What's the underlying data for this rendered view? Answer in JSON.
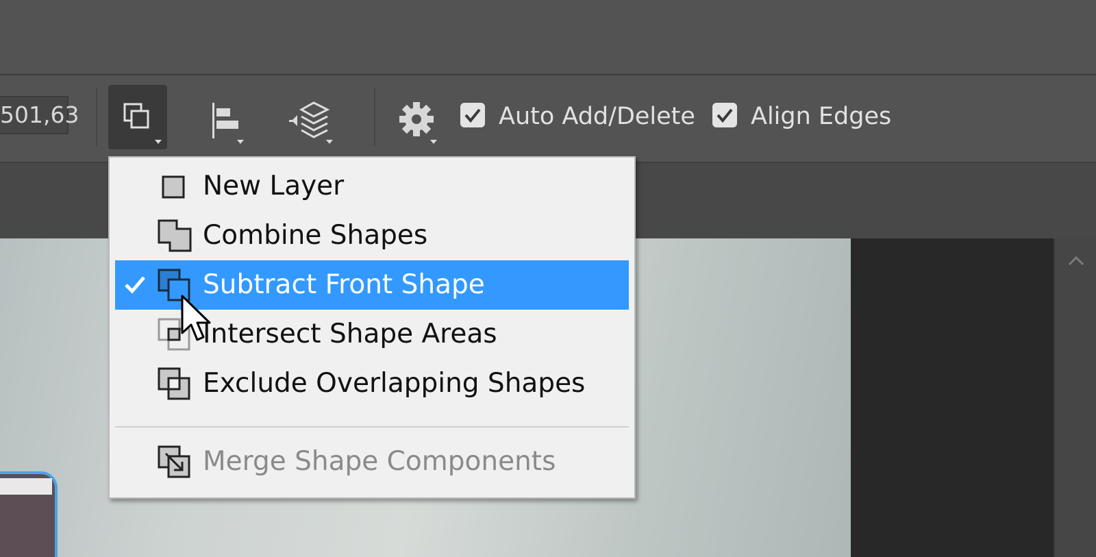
{
  "options_bar": {
    "coord_value": "501,63",
    "path_operations_icon": "path-operations-icon",
    "path_alignment_icon": "path-alignment-icon",
    "path_arrangement_icon": "path-arrangement-icon",
    "settings_icon": "gear-icon",
    "auto_add_delete": {
      "label": "Auto Add/Delete",
      "checked": true
    },
    "align_edges": {
      "label": "Align Edges",
      "checked": true
    }
  },
  "path_operations_menu": {
    "items": [
      {
        "label": "New Layer",
        "icon": "new-layer-icon",
        "selected": false,
        "checked": false,
        "enabled": true
      },
      {
        "label": "Combine Shapes",
        "icon": "combine-shapes-icon",
        "selected": false,
        "checked": false,
        "enabled": true
      },
      {
        "label": "Subtract Front Shape",
        "icon": "subtract-front-shape-icon",
        "selected": true,
        "checked": true,
        "enabled": true
      },
      {
        "label": "Intersect Shape Areas",
        "icon": "intersect-shape-areas-icon",
        "selected": false,
        "checked": false,
        "enabled": true
      },
      {
        "label": "Exclude Overlapping Shapes",
        "icon": "exclude-overlapping-shapes-icon",
        "selected": false,
        "checked": false,
        "enabled": true
      },
      {
        "label": "Merge Shape Components",
        "icon": "merge-shape-components-icon",
        "selected": false,
        "checked": false,
        "enabled": false
      }
    ]
  },
  "colors": {
    "toolbar_bg": "#535353",
    "menu_bg": "#f0f0f0",
    "selection": "#3399ff",
    "disabled_text": "#8a8a8a"
  }
}
